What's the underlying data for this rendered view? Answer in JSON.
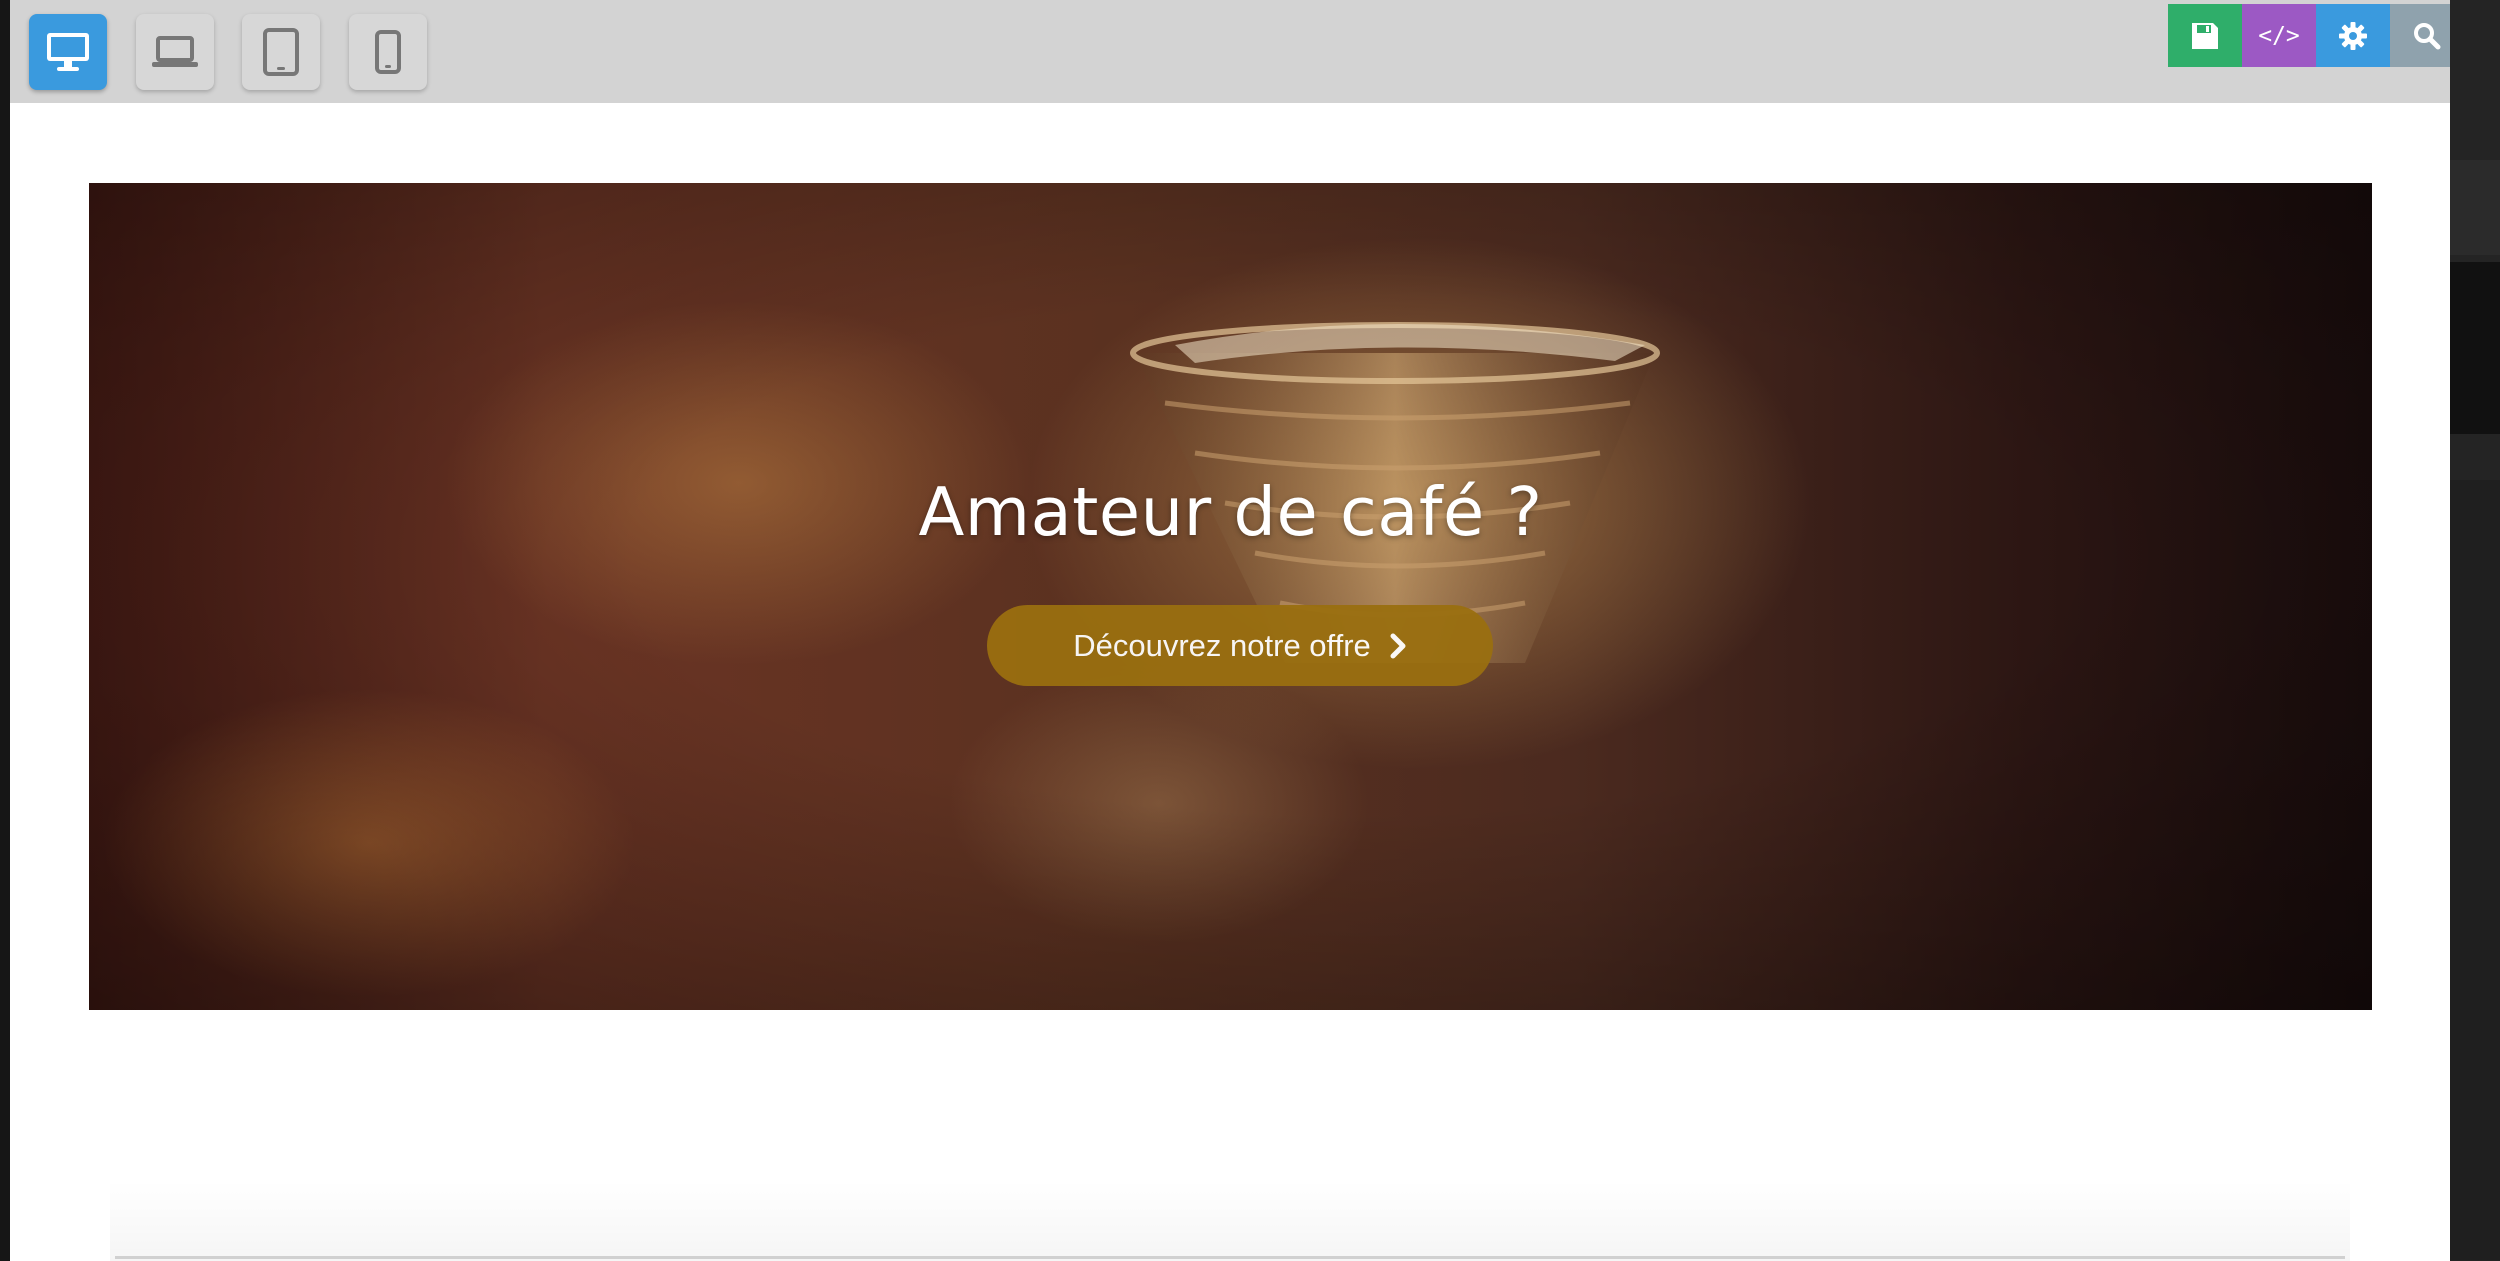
{
  "toolbar": {
    "devices": [
      {
        "name": "desktop",
        "icon": "desktop-icon",
        "active": true
      },
      {
        "name": "laptop",
        "icon": "laptop-icon",
        "active": false
      },
      {
        "name": "tablet",
        "icon": "tablet-icon",
        "active": false
      },
      {
        "name": "mobile",
        "icon": "mobile-icon",
        "active": false
      }
    ],
    "actions": {
      "save_icon": "save-icon",
      "code_label": "</>",
      "settings_icon": "gear-icon",
      "search_icon": "search-icon"
    },
    "colors": {
      "toolbar_bg": "#d3d3d3",
      "active_device": "#3a9ade",
      "save": "#2fae6a",
      "code": "#9c59c4",
      "settings": "#3a9ade",
      "search": "#8fa2ad"
    }
  },
  "hero": {
    "title": "Amateur de café ?",
    "cta_label": "Découvrez notre offre",
    "cta_icon": "chevron-right-icon",
    "cta_color": "#9a6f10"
  }
}
